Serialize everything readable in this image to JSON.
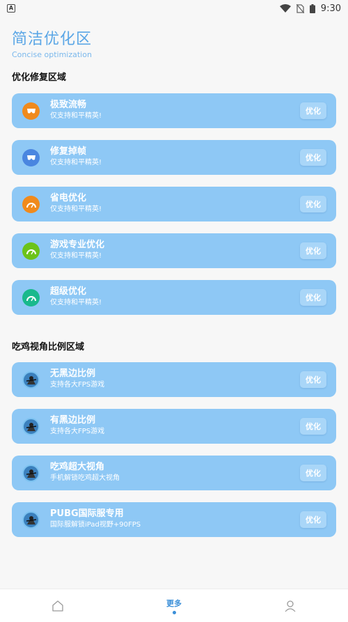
{
  "status_bar": {
    "time": "9:30",
    "left_icon": "A"
  },
  "header": {
    "title": "简洁优化区",
    "subtitle": "Concise optimization"
  },
  "section1": {
    "title": "优化修复区域",
    "items": [
      {
        "title": "极致流畅",
        "subtitle": "仅支持和平精英!",
        "button": "优化",
        "icon_color": "#f08a1c",
        "icon": "glasses-icon"
      },
      {
        "title": "修复掉帧",
        "subtitle": "仅支持和平精英!",
        "button": "优化",
        "icon_color": "#4a86e0",
        "icon": "glasses-icon"
      },
      {
        "title": "省电优化",
        "subtitle": "仅支持和平精英!",
        "button": "优化",
        "icon_color": "#f08a1c",
        "icon": "gauge-icon"
      },
      {
        "title": "游戏专业优化",
        "subtitle": "仅支持和平精英!",
        "button": "优化",
        "icon_color": "#6cc31a",
        "icon": "gauge-icon"
      },
      {
        "title": "超级优化",
        "subtitle": "仅支持和平精英!",
        "button": "优化",
        "icon_color": "#19b98c",
        "icon": "gauge-icon"
      }
    ]
  },
  "section2": {
    "title": "吃鸡视角比例区域",
    "items": [
      {
        "title": "无黑边比例",
        "subtitle": "支持各大FPS游戏",
        "button": "优化",
        "icon": "pubg-character-icon"
      },
      {
        "title": "有黑边比例",
        "subtitle": "支持各大FPS游戏",
        "button": "优化",
        "icon": "pubg-character-icon"
      },
      {
        "title": "吃鸡超大视角",
        "subtitle": "手机解锁吃鸡超大视角",
        "button": "优化",
        "icon": "pubg-character-icon"
      },
      {
        "title": "PUBG国际服专用",
        "subtitle": "国际服解锁iPad视野+90FPS",
        "button": "优化",
        "icon": "pubg-character-icon"
      }
    ]
  },
  "bottom_nav": {
    "home_icon": "home-icon",
    "more_label": "更多",
    "profile_icon": "user-icon"
  },
  "colors": {
    "accent": "#5aa6e6",
    "card": "#8ec8f5",
    "button": "#a9d6f8",
    "nav_active": "#3b8fd8"
  }
}
